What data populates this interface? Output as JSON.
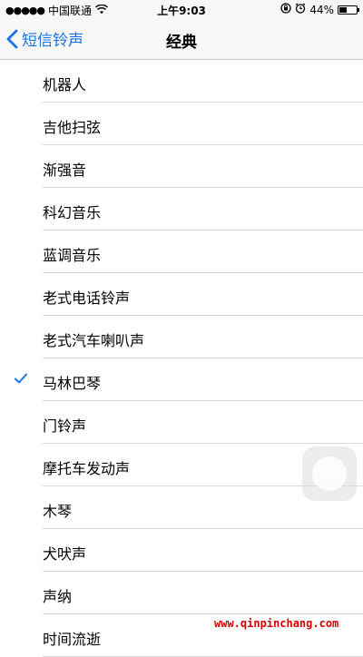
{
  "status_bar": {
    "signal": "●●●●●",
    "carrier": "中国联通",
    "time": "上午9:03",
    "battery_text": "44%",
    "battery_level": 0.44,
    "icons": [
      "wifi-icon",
      "lock-rotation-icon",
      "alarm-icon",
      "battery-icon"
    ]
  },
  "nav": {
    "back_label": "短信铃声",
    "title": "经典"
  },
  "list": {
    "items": [
      {
        "label": "机器人",
        "checked": false
      },
      {
        "label": "吉他扫弦",
        "checked": false
      },
      {
        "label": "渐强音",
        "checked": false
      },
      {
        "label": "科幻音乐",
        "checked": false
      },
      {
        "label": "蓝调音乐",
        "checked": false
      },
      {
        "label": "老式电话铃声",
        "checked": false
      },
      {
        "label": "老式汽车喇叭声",
        "checked": false
      },
      {
        "label": "马林巴琴",
        "checked": true
      },
      {
        "label": "门铃声",
        "checked": false
      },
      {
        "label": "摩托车发动声",
        "checked": false
      },
      {
        "label": "木琴",
        "checked": false
      },
      {
        "label": "犬吠声",
        "checked": false
      },
      {
        "label": "声纳",
        "checked": false
      },
      {
        "label": "时间流逝",
        "checked": false
      }
    ]
  },
  "colors": {
    "accent": "#1a73e8",
    "watermark": "#d60000"
  },
  "watermark": "www.qinpinchang.com"
}
